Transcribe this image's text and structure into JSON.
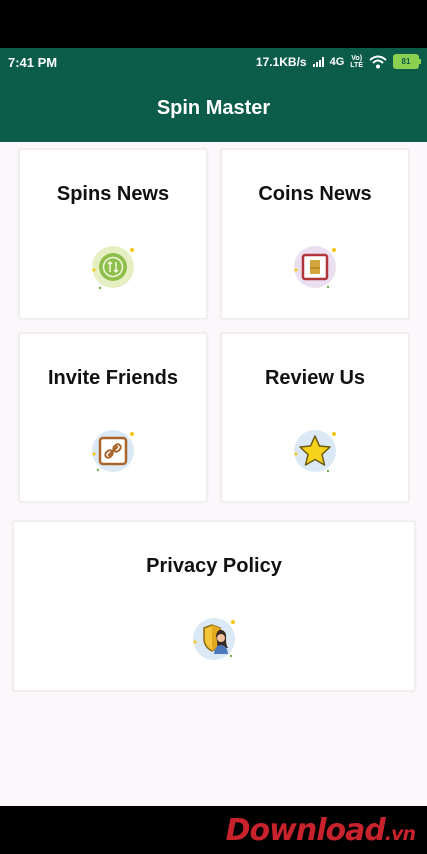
{
  "status_bar": {
    "time": "7:41 PM",
    "speed": "17.1KB/s",
    "network": "4G",
    "volte_top": "Vo)",
    "volte_bottom": "LTE",
    "battery": "81"
  },
  "app_bar": {
    "title": "Spin Master"
  },
  "menu": {
    "spins_news": "Spins News",
    "coins_news": "Coins News",
    "invite_friends": "Invite Friends",
    "review_us": "Review Us",
    "privacy_policy": "Privacy Policy"
  },
  "watermark": {
    "main": "Download",
    "suffix": ".vn"
  },
  "colors": {
    "brand": "#0c5c4a",
    "background": "#fbf7fb",
    "watermark": "#c8232c"
  }
}
